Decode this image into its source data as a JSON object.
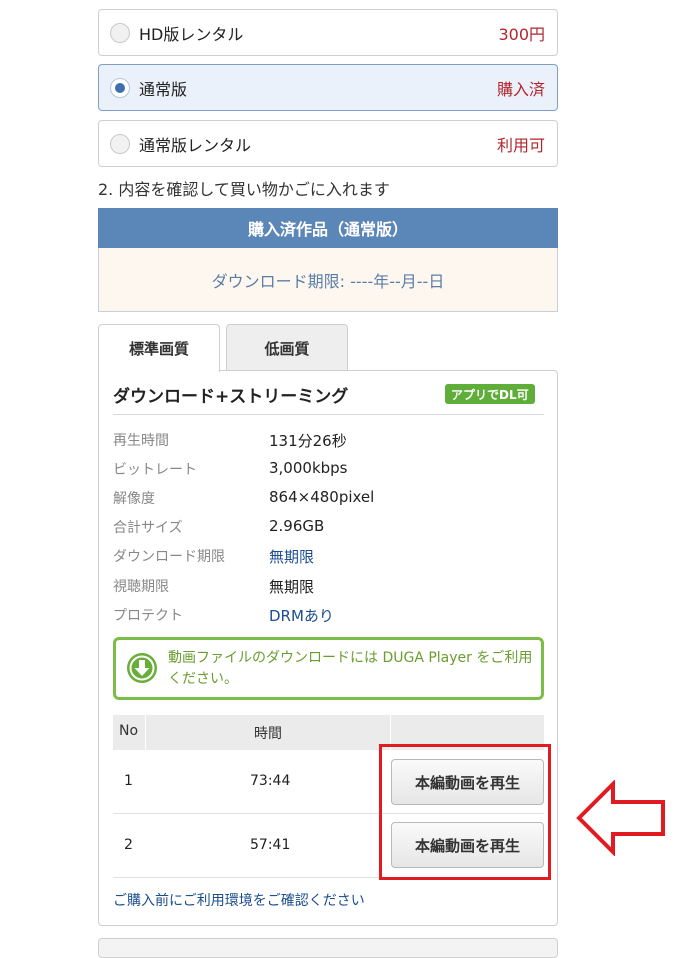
{
  "options": [
    {
      "label": "HD版レンタル",
      "price": "300円"
    },
    {
      "label": "通常版",
      "price": "購入済"
    },
    {
      "label": "通常版レンタル",
      "price": "利用可"
    }
  ],
  "step2_label": "2. 内容を確認して買い物かごに入れます",
  "purchased": {
    "title": "購入済作品（通常版）",
    "download_deadline": "ダウンロード期限: ----年--月--日"
  },
  "tabs": [
    "標準画質",
    "低画質"
  ],
  "panel": {
    "title": "ダウンロード+ストリーミング",
    "badge": "アプリでDL可",
    "specs": [
      {
        "key": "再生時間",
        "value": "131分26秒"
      },
      {
        "key": "ビットレート",
        "value": "3,000kbps"
      },
      {
        "key": "解像度",
        "value": "864×480pixel"
      },
      {
        "key": "合計サイズ",
        "value": "2.96GB"
      },
      {
        "key": "ダウンロード期限",
        "value": "無期限"
      },
      {
        "key": "視聴期限",
        "value": "無期限"
      },
      {
        "key": "プロテクト",
        "value": "DRMあり"
      }
    ],
    "notice": "動画ファイルのダウンロードには DUGA Player をご利用ください。",
    "table": {
      "headers": [
        "No",
        "時間"
      ],
      "rows": [
        {
          "no": "1",
          "time": "73:44",
          "button": "本編動画を再生"
        },
        {
          "no": "2",
          "time": "57:41",
          "button": "本編動画を再生"
        }
      ]
    },
    "env_link": "ご購入前にご利用環境をご確認ください"
  },
  "colors": {
    "accent_blue": "#5b86b8",
    "price_red": "#b2262c",
    "green": "#6aae3a",
    "highlight_red": "#e01b22"
  },
  "icons": [
    "download-circle-icon",
    "arrow-left-outline-icon"
  ]
}
